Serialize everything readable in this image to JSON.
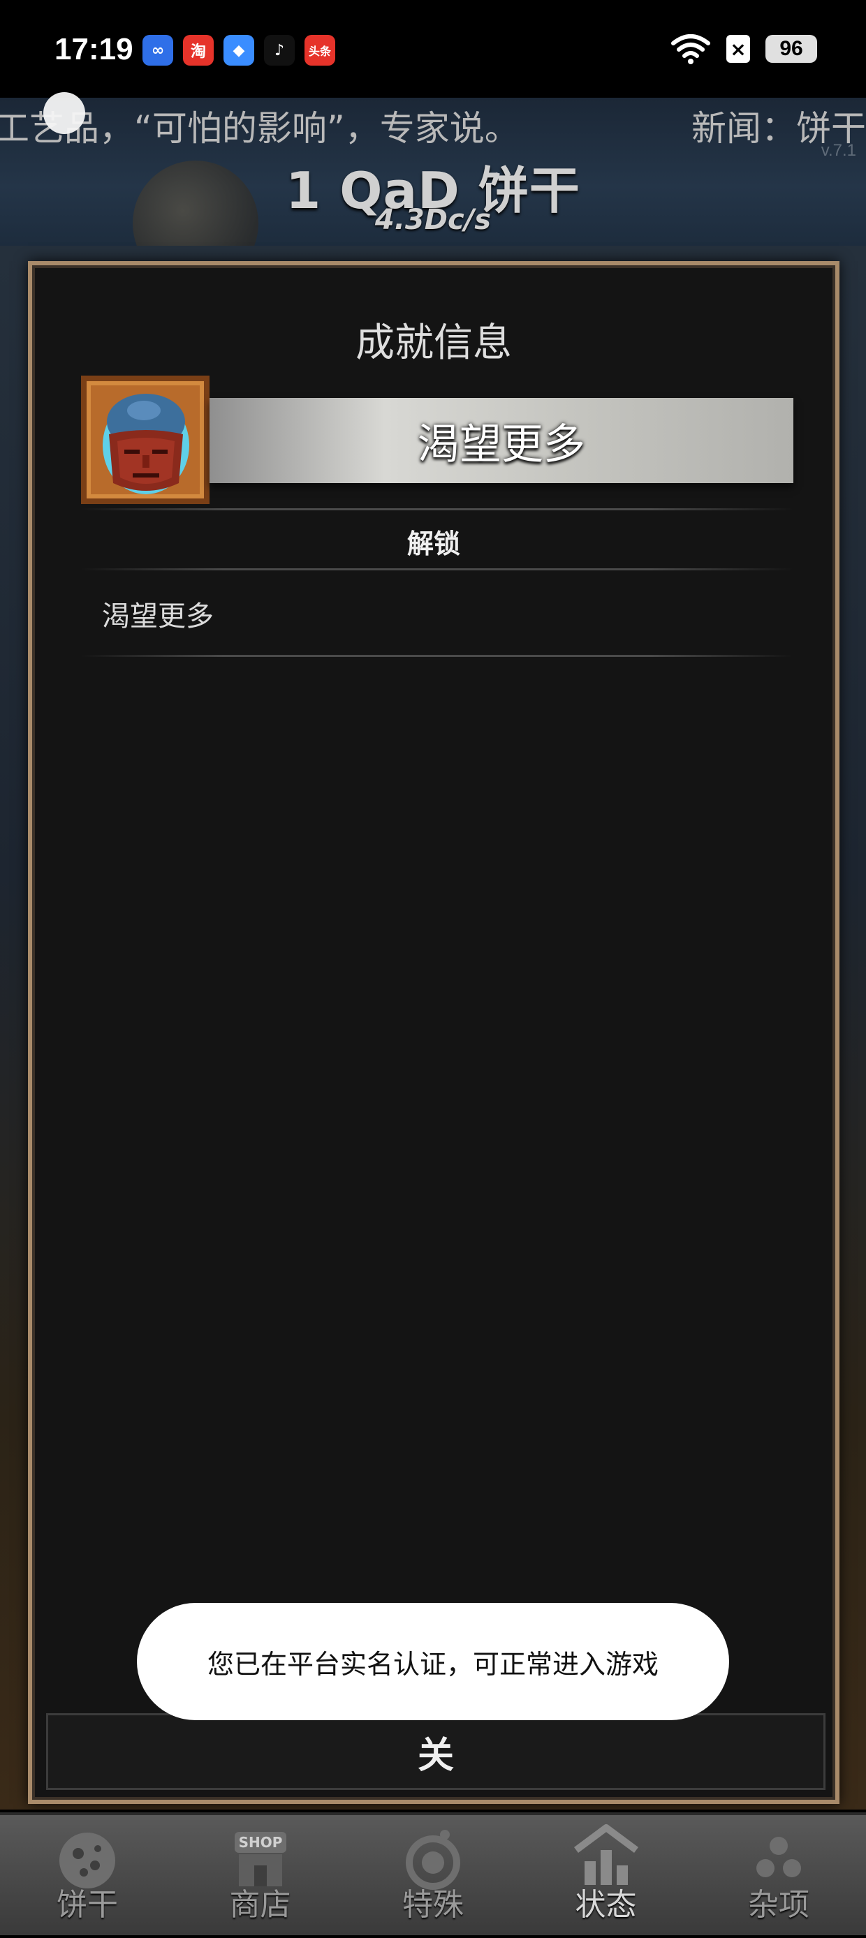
{
  "status_bar": {
    "time": "17:19",
    "app_icons": [
      {
        "name": "baidu-netdisk-icon",
        "glyph": "∞",
        "color": "#2f6fe8"
      },
      {
        "name": "taobao-icon",
        "glyph": "淘",
        "color": "#e6332a"
      },
      {
        "name": "browser-icon",
        "glyph": "◆",
        "color": "#3a8dff"
      },
      {
        "name": "douyin-icon",
        "glyph": "♪",
        "color": "#111111"
      },
      {
        "name": "toutiao-icon",
        "glyph": "头条",
        "color": "#e6332a"
      }
    ],
    "battery": "96"
  },
  "header": {
    "ticker_left": "工艺品，“可怕的影响”，专家说。",
    "ticker_right": "新闻：饼干",
    "version": "v.7.1",
    "cookie_count": "1 QaD 饼干",
    "cookies_per_second": "4.3Dc/s"
  },
  "achievement": {
    "panel_title": "成就信息",
    "name": "渴望更多",
    "section_label": "解锁",
    "description": "渴望更多",
    "close_label": "关"
  },
  "toast": {
    "text": "您已在平台实名认证，可正常进入游戏"
  },
  "bottom_nav": {
    "items": [
      {
        "label": "饼干",
        "icon": "cookie-icon"
      },
      {
        "label": "商店",
        "icon": "shop-icon"
      },
      {
        "label": "特殊",
        "icon": "special-icon"
      },
      {
        "label": "状态",
        "icon": "stats-icon",
        "active": true
      },
      {
        "label": "杂项",
        "icon": "misc-icon"
      }
    ]
  }
}
